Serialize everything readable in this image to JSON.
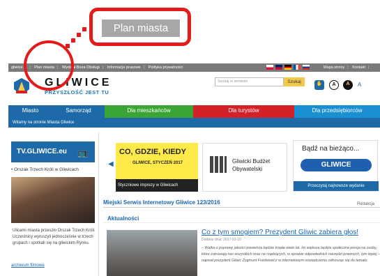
{
  "callout": {
    "label": "Plan miasta"
  },
  "topbar": {
    "links": [
      "gliwice.pl",
      "Plan miasta",
      "Wydział Biura Obsługi",
      "Informacje prasowe",
      "Polityka prywatności"
    ],
    "right_links": [
      "Mapa strony",
      "Kontakt",
      "BIP"
    ],
    "flags": [
      {
        "name": "pl-flag",
        "top": "#ffffff",
        "bottom": "#dc143c"
      },
      {
        "name": "gb-flag",
        "top": "#012169",
        "bottom": "#c8102e"
      },
      {
        "name": "de-flag",
        "top": "#000000",
        "bottom": "#ffce00"
      },
      {
        "name": "fr-flag",
        "top": "#0055a4",
        "bottom": "#ef4135"
      },
      {
        "name": "ru-flag",
        "top": "#ffffff",
        "bottom": "#0039a6"
      }
    ]
  },
  "header": {
    "logo_title": "GLIWICE",
    "logo_subtitle": "PRZYSZŁOŚĆ JEST TU",
    "search_placeholder": "Szukaj w serwisie",
    "search_button": "Szukaj",
    "contrast_labels": [
      "A",
      "A"
    ],
    "font_size_label": "A"
  },
  "nav": {
    "tabs": [
      {
        "label": "Miasto",
        "color": "#1e6aa8"
      },
      {
        "label": "Samorząd",
        "color": "#1e6aa8"
      },
      {
        "label": "Dla mieszkańców",
        "color": "#3aa535"
      },
      {
        "label": "Dla turystów",
        "color": "#d42127"
      },
      {
        "label": "Dla przedsiębiorców",
        "color": "#1a8fd1"
      }
    ],
    "welcome": "Witamy na stronie Miasta Gliwice"
  },
  "sidebar": {
    "tv_title": "TV.GLIWICE.eu",
    "item": "Orszak Trzech Króli w Gliwicach",
    "text": "Ulicami miasta przeszło Orszak Trzech Króli. Uczestnicy wyruszyli jednocześnie w trzech grupach i spotkali się na gliwickim Rynku.",
    "archive": "archiwum filmowe"
  },
  "banners": {
    "b1_title": "CO, GDZIE, KIEDY",
    "b1_sub": "GLIWICE, STYCZEŃ 2017",
    "b1_bottom": "Styczniowe imprezy w Gliwicach",
    "b2_title": "Gliwicki Budżet Obywatelski",
    "b3_title": "Bądź na bieżąco...",
    "b3_pill": "GLIWICE",
    "b3_bottom": "Przeczytaj najnowsze wydanie"
  },
  "main": {
    "section_title": "Miejski Serwis Internetowy Gliwice 123/2016",
    "redakcja": "Redakcja",
    "news_heading": "Aktualności",
    "news_title": "Co z tym smogiem? Prezydent Gliwic zabiera głos!",
    "news_date": "Dodano dnia:  2017-01-10",
    "news_body": "– Walka o poprawę jakości powietrza będzie trwała wiele lat. Im większa będzie społeczna presja na osoby, które zatruwają nas wszystkich oraz na rządzących, w sprawie odpowiednich narzędzi prawnych, tym lepiej – napisał prezydent Gliwic Zygmunt Frankiewicz w internetowym oświadczeniu odnosząc się do tematu"
  }
}
